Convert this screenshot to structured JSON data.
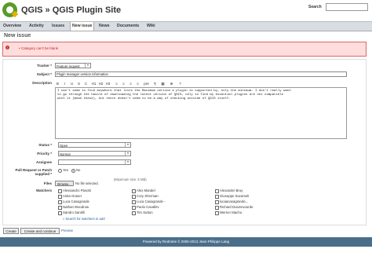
{
  "header": {
    "title": "QGIS » QGIS Plugin Site",
    "search_label": "Search"
  },
  "nav": {
    "items": [
      "Overview",
      "Activity",
      "Issues",
      "New issue",
      "News",
      "Documents",
      "Wiki"
    ],
    "active": "New issue"
  },
  "page": {
    "heading": "New issue"
  },
  "error": {
    "message": "• Category can't be blank"
  },
  "form": {
    "tracker_label": "Tracker *",
    "tracker_value": "Feature request",
    "subject_label": "Subject *",
    "subject_value": "Plugin manager version information",
    "description_label": "Description",
    "toolbar": [
      "B",
      "I",
      "U",
      "S",
      "C",
      "H1",
      "H2",
      "H3",
      "≡",
      "≡",
      "≡",
      "≡",
      "pre",
      "¶",
      "▦",
      "⊕",
      "?"
    ],
    "description_lines": [
      "I can't seem to find anywhere that lists the Maximum version a plugin is supported by, only the minimum. I don't really want",
      "to go through the hassle of downloading the latest version of QGIS, only to find my essential plugins are not compatible",
      "with it (mean these), but there doesn't seem to be a way of checking outside of QGIS itself."
    ],
    "status_label": "Status *",
    "status_value": "Open",
    "priority_label": "Priority *",
    "priority_value": "Normal",
    "assignee_label": "Assignee",
    "pullrequest_label": "Pull Request or Patch supplied *",
    "pr_yes": "Yes",
    "pr_no": "No",
    "files_label": "Files",
    "browse_label": "Browse...",
    "no_file": "No file selected.",
    "max_size": "(Maximum size: 5 MB)",
    "watchers_label": "Watchers",
    "watchers": [
      [
        "Alessandro Pasotti",
        "Alex Mandel",
        "Alexander Bruy"
      ],
      [
        "Anita Graser",
        "Cory Sherman",
        "Giuseppe Sucameli"
      ],
      [
        "Luca Casagrande",
        "Luca Casagrande -",
        "lucaacasagrande..."
      ],
      [
        "Nathan Woodrow",
        "Paolo Cavallini",
        "Richard Duivenvoorde"
      ],
      [
        "Sandro Santilli",
        "Tim Sutton",
        "Werner Macho"
      ]
    ],
    "search_watchers": "» Search for watchers to add"
  },
  "buttons": {
    "create": "Create",
    "create_continue": "Create and continue",
    "preview": "Preview"
  },
  "footer": {
    "text": "Powered by Redmine © 2006-2013 Jean-Philippe Lang"
  }
}
